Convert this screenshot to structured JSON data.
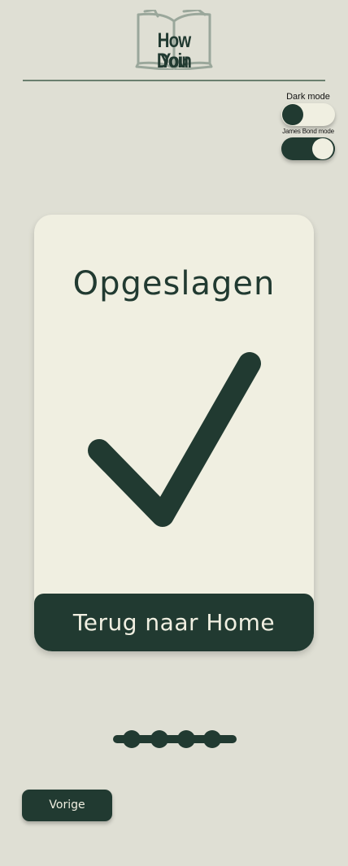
{
  "header": {
    "logo": {
      "line1": "How You",
      "line2": "Doin",
      "icon": "open-book-icon"
    }
  },
  "settings": {
    "dark_mode": {
      "label": "Dark mode",
      "on": false
    },
    "james_bond_mode": {
      "label": "James Bond mode",
      "on": true
    }
  },
  "card": {
    "title": "Opgeslagen",
    "icon": "checkmark-icon",
    "home_button_label": "Terug naar Home"
  },
  "progress": {
    "total_steps": 4,
    "icon": "progress-dots"
  },
  "footer": {
    "prev_button_label": "Vorige"
  },
  "colors": {
    "background": "#dfdfd4",
    "card": "#f0efe1",
    "accent": "#213a31",
    "divider": "#6b7f6f"
  }
}
